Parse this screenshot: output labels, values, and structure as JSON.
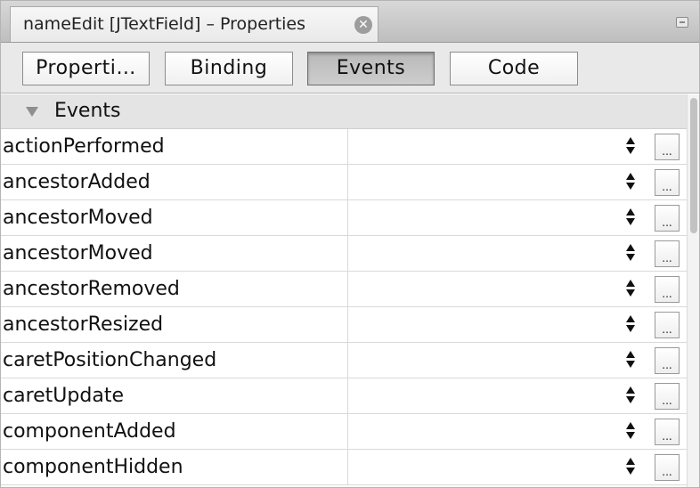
{
  "window": {
    "tab_title": "nameEdit [JTextField] – Properties",
    "close_glyph": "✕"
  },
  "toolbar": {
    "buttons": [
      {
        "label": "Properti…",
        "active": false
      },
      {
        "label": "Binding",
        "active": false
      },
      {
        "label": "Events",
        "active": true
      },
      {
        "label": "Code",
        "active": false
      }
    ]
  },
  "section": {
    "title": "Events",
    "expanded": true
  },
  "rows": [
    {
      "name": "actionPerformed",
      "value": ""
    },
    {
      "name": "ancestorAdded",
      "value": ""
    },
    {
      "name": "ancestorMoved",
      "value": ""
    },
    {
      "name": "ancestorMoved",
      "value": ""
    },
    {
      "name": "ancestorRemoved",
      "value": ""
    },
    {
      "name": "ancestorResized",
      "value": ""
    },
    {
      "name": "caretPositionChanged",
      "value": ""
    },
    {
      "name": "caretUpdate",
      "value": ""
    },
    {
      "name": "componentAdded",
      "value": ""
    },
    {
      "name": "componentHidden",
      "value": ""
    }
  ],
  "row_button_label": "...",
  "colors": {
    "active_button": "#c4c4c4",
    "section_header": "#e4e4e4",
    "grid_line": "#d9d9d9"
  }
}
